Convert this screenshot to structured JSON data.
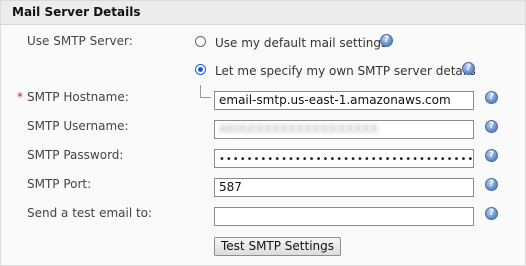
{
  "panel": {
    "title": "Mail Server Details"
  },
  "use_smtp": {
    "label": "Use SMTP Server:",
    "options": [
      {
        "label": "Use my default mail settings",
        "selected": false
      },
      {
        "label": "Let me specify my own SMTP server details",
        "selected": true
      }
    ]
  },
  "fields": {
    "hostname": {
      "required_marker": "*",
      "label": "SMTP Hostname:",
      "value": "email-smtp.us-east-1.amazonaws.com"
    },
    "username": {
      "label": "SMTP Username:",
      "value": "AKIAXXXXXXXXXXXXXXXX"
    },
    "password": {
      "label": "SMTP Password:",
      "value": "••••••••••••••••••••••••••••••••••••••••••••"
    },
    "port": {
      "label": "SMTP Port:",
      "value": "587"
    },
    "test_email": {
      "label": "Send a test email to:",
      "value": ""
    }
  },
  "help_icon_glyph": "?",
  "buttons": {
    "test_smtp": "Test SMTP Settings"
  },
  "colors": {
    "accent": "#1a5fd0",
    "required": "#cc2222",
    "header_bg": "#ececec"
  }
}
